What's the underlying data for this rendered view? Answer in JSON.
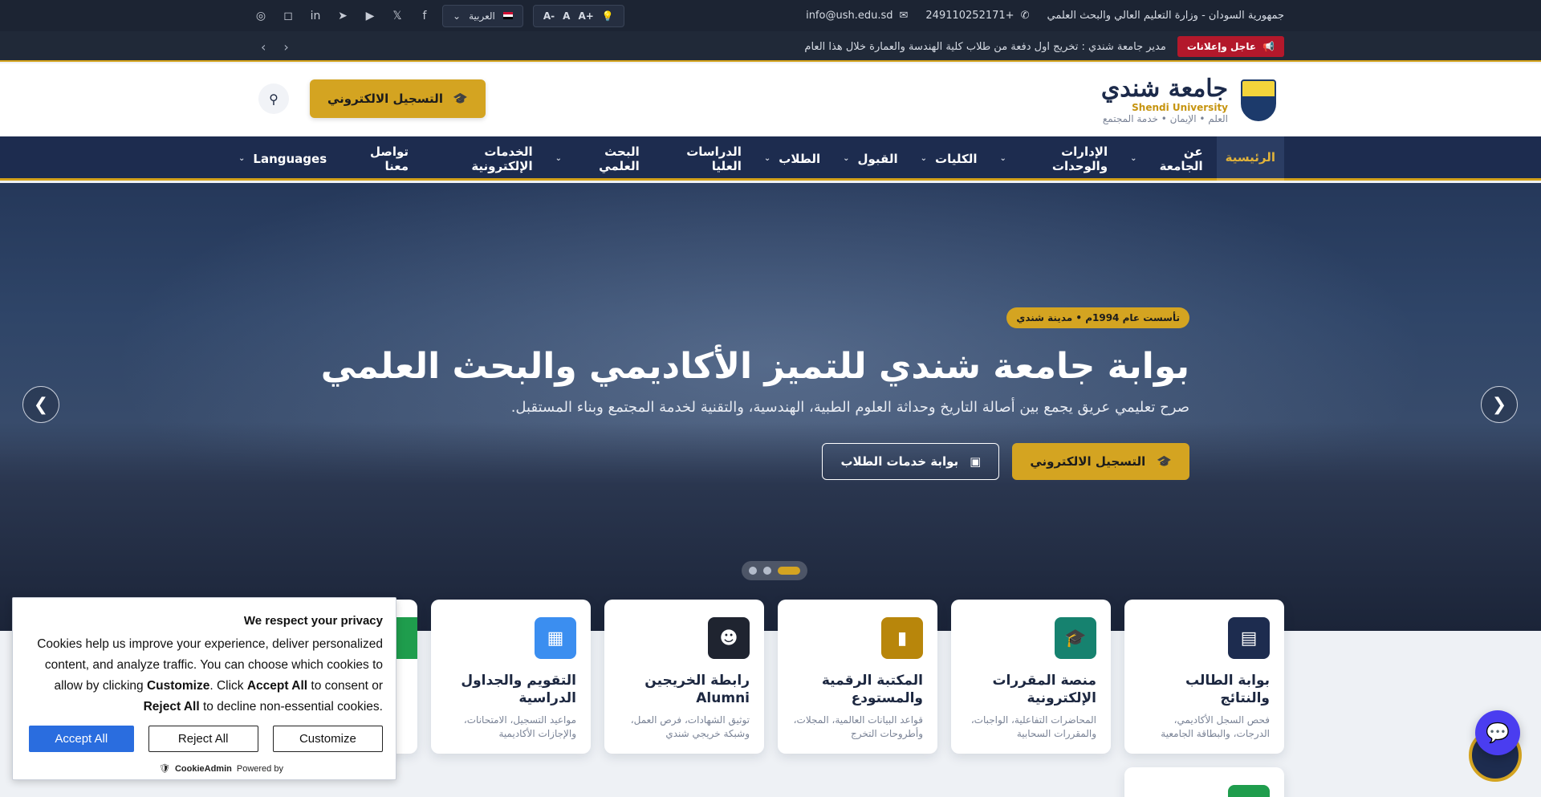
{
  "topbar": {
    "ministry": "جمهورية السودان - وزارة التعليم العالي والبحث العلمي",
    "phone": "+249110252171",
    "email": "info@ush.edu.sd",
    "font_controls": [
      "-A",
      "A",
      "+A"
    ],
    "language": "العربية",
    "social": [
      "facebook-icon",
      "x-icon",
      "youtube-icon",
      "telegram-icon",
      "linkedin-icon",
      "instagram-icon",
      "whatsapp-icon"
    ]
  },
  "ticker": {
    "label": "عاجل وإعلانات",
    "text": "مدير جامعة شندي : تخريج اول دفعة من طلاب كلية الهندسة والعمارة خلال هذا العام"
  },
  "header": {
    "name_ar": "جامعة شندي",
    "name_en": "Shendi University",
    "slogan": "العلم • الإيمان • خدمة المجتمع",
    "register_label": "التسجيل الالكتروني"
  },
  "nav": [
    {
      "label": "الرئيسية",
      "dropdown": false,
      "active": true
    },
    {
      "label": "عن الجامعة",
      "dropdown": true
    },
    {
      "label": "الإدارات والوحدات",
      "dropdown": true
    },
    {
      "label": "الكليات",
      "dropdown": true
    },
    {
      "label": "القبول",
      "dropdown": true
    },
    {
      "label": "الطلاب",
      "dropdown": true
    },
    {
      "label": "الدراسات العليا",
      "dropdown": false
    },
    {
      "label": "البحث العلمي",
      "dropdown": true
    },
    {
      "label": "الخدمات الإلكترونية",
      "dropdown": false
    },
    {
      "label": "تواصل معنا",
      "dropdown": false
    },
    {
      "label": "Languages",
      "dropdown": true
    }
  ],
  "hero": {
    "badge": "تأسست عام 1994م • مدينة شندي",
    "title": "بوابة جامعة شندي للتميز الأكاديمي والبحث العلمي",
    "subtitle": "صرح تعليمي عريق يجمع بين أصالة التاريخ وحداثة العلوم الطبية، الهندسية، والتقنية لخدمة المجتمع وبناء المستقبل.",
    "primary_btn": "التسجيل الالكتروني",
    "secondary_btn": "بوابة خدمات الطلاب",
    "slides": 3,
    "active_slide": 1
  },
  "cards": [
    {
      "title": "بوابة الطالب والنتائج",
      "desc": "فحص السجل الأكاديمي، الدرجات، والبطاقة الجامعية",
      "color": "#1d2c4f",
      "icon": "id-card-icon"
    },
    {
      "title": "منصة المقررات الإلكترونية",
      "desc": "المحاضرات التفاعلية، الواجبات، والمقررات السحابية",
      "color": "#16826f",
      "icon": "graduation-cap-icon"
    },
    {
      "title": "المكتبة الرقمية والمستودع",
      "desc": "قواعد البيانات العالمية، المجلات، وأطروحات التخرج",
      "color": "#b8860b",
      "icon": "book-icon"
    },
    {
      "title": "رابطة الخريجين Alumni",
      "desc": "توثيق الشهادات، فرص العمل، وشبكة خريجي شندي",
      "color": "#1f2430",
      "icon": "users-icon"
    },
    {
      "title": "التقويم والجداول الدراسية",
      "desc": "مواعيد التسجيل، الامتحانات، والإجازات الأكاديمية",
      "color": "#3b8ef0",
      "icon": "calendar-icon"
    }
  ],
  "cookie": {
    "title": "We respect your privacy",
    "text_1": "Cookies help us improve your experience, deliver personalized content, and analyze traffic. You can choose which cookies to allow by clicking ",
    "customize_word": "Customize",
    "text_2": ". Click ",
    "accept_word": "Accept All",
    "text_3": " to consent or ",
    "reject_word": "Reject All",
    "text_4": " to decline non-essential cookies.",
    "accept_btn": "Accept All",
    "reject_btn": "Reject All",
    "customize_btn": "Customize",
    "powered_by": "Powered by",
    "brand": "CookieAdmin"
  }
}
